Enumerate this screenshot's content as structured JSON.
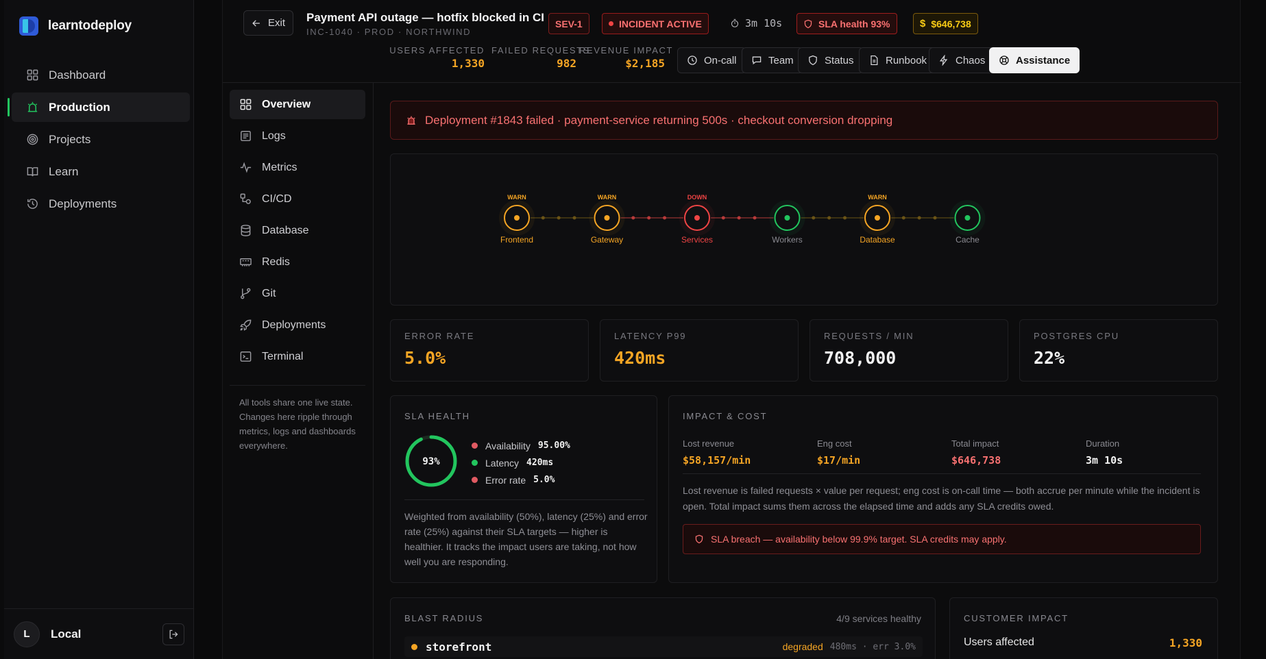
{
  "app": {
    "brand": "learntodeploy",
    "nav": [
      {
        "label": "Dashboard",
        "icon": "dashboard-icon"
      },
      {
        "label": "Production",
        "icon": "siren-icon",
        "active": true
      },
      {
        "label": "Projects",
        "icon": "target-icon"
      },
      {
        "label": "Learn",
        "icon": "book-icon"
      },
      {
        "label": "Deployments",
        "icon": "history-icon"
      }
    ],
    "user": {
      "initial": "L",
      "name": "Local"
    }
  },
  "incident": {
    "exit_label": "Exit",
    "title": "Payment API outage — hotfix blocked in CI",
    "subtitle": "INC-1040 · PROD · NORTHWIND",
    "severity": "SEV-1",
    "status": "INCIDENT ACTIVE",
    "elapsed": "3m 10s",
    "sla_health": "SLA health 93%",
    "impact_total": "$646,738",
    "stats": [
      {
        "label": "USERS AFFECTED",
        "value": "1,330"
      },
      {
        "label": "FAILED REQUESTS",
        "value": "982"
      },
      {
        "label": "REVENUE IMPACT",
        "value": "$2,185"
      }
    ],
    "tools": [
      {
        "label": "On-call",
        "icon": "clock-icon"
      },
      {
        "label": "Team",
        "icon": "chat-icon"
      },
      {
        "label": "Status",
        "icon": "shield-icon"
      },
      {
        "label": "Runbook",
        "icon": "document-icon"
      },
      {
        "label": "Chaos",
        "icon": "lightning-icon"
      },
      {
        "label": "Assistance",
        "icon": "lifebuoy-icon",
        "primary": true
      }
    ]
  },
  "subnav": {
    "items": [
      {
        "label": "Overview",
        "icon": "grid-icon",
        "active": true
      },
      {
        "label": "Logs",
        "icon": "logs-icon"
      },
      {
        "label": "Metrics",
        "icon": "activity-icon"
      },
      {
        "label": "CI/CD",
        "icon": "pipeline-icon"
      },
      {
        "label": "Database",
        "icon": "database-icon"
      },
      {
        "label": "Redis",
        "icon": "memory-icon"
      },
      {
        "label": "Git",
        "icon": "git-branch-icon"
      },
      {
        "label": "Deployments",
        "icon": "rocket-icon"
      },
      {
        "label": "Terminal",
        "icon": "terminal-icon"
      }
    ],
    "note": "All tools share one live state. Changes here ripple through metrics, logs and dashboards everywhere."
  },
  "banner": {
    "text": "Deployment #1843 failed · payment-service returning 500s · checkout conversion dropping",
    "icon": "siren-icon"
  },
  "topology": {
    "nodes": [
      {
        "name": "Frontend",
        "status": "WARN",
        "color": "#f5a524"
      },
      {
        "name": "Gateway",
        "status": "WARN",
        "color": "#f5a524"
      },
      {
        "name": "Services",
        "status": "DOWN",
        "color": "#ef4444"
      },
      {
        "name": "Workers",
        "status": "",
        "color": "#22c55e"
      },
      {
        "name": "Database",
        "status": "WARN",
        "color": "#f5a524"
      },
      {
        "name": "Cache",
        "status": "",
        "color": "#22c55e"
      }
    ]
  },
  "metrics": [
    {
      "label": "ERROR RATE",
      "value": "5.0%",
      "color": "#f5a524"
    },
    {
      "label": "LATENCY P99",
      "value": "420ms",
      "color": "#f5a524"
    },
    {
      "label": "REQUESTS / MIN",
      "value": "708,000",
      "color": "#f2f2f2"
    },
    {
      "label": "POSTGRES CPU",
      "value": "22%",
      "color": "#f2f2f2"
    }
  ],
  "sla": {
    "title": "SLA HEALTH",
    "score_label": "93%",
    "score": 0.93,
    "rows": [
      {
        "label": "Availability",
        "value": "95.00%",
        "color": "#e05a62"
      },
      {
        "label": "Latency",
        "value": "420ms",
        "color": "#22c55e"
      },
      {
        "label": "Error rate",
        "value": "5.0%",
        "color": "#e05a62"
      }
    ],
    "description": "Weighted from availability (50%), latency (25%) and error rate (25%) against their SLA targets — higher is healthier. It tracks the impact users are taking, not how well you are responding."
  },
  "impact": {
    "title": "IMPACT & COST",
    "cols": [
      {
        "label": "Lost revenue",
        "value": "$58,157/min",
        "color": "#f5a524"
      },
      {
        "label": "Eng cost",
        "value": "$17/min",
        "color": "#f5a524"
      },
      {
        "label": "Total impact",
        "value": "$646,738",
        "color": "#f87171"
      },
      {
        "label": "Duration",
        "value": "3m 10s",
        "color": "#f2f2f2"
      }
    ],
    "description": "Lost revenue is failed requests × value per request; eng cost is on-call time — both accrue per minute while the incident is open. Total impact sums them across the elapsed time and adds any SLA credits owed.",
    "breach": "SLA breach — availability below 99.9% target. SLA credits may apply."
  },
  "blast": {
    "title": "BLAST RADIUS",
    "count": "4/9 services healthy",
    "rows": [
      {
        "name": "storefront",
        "status": "degraded",
        "meta": "480ms · err 3.0%"
      }
    ]
  },
  "customer": {
    "title": "CUSTOMER IMPACT",
    "rows": [
      {
        "label": "Users affected",
        "value": "1,330"
      }
    ]
  }
}
